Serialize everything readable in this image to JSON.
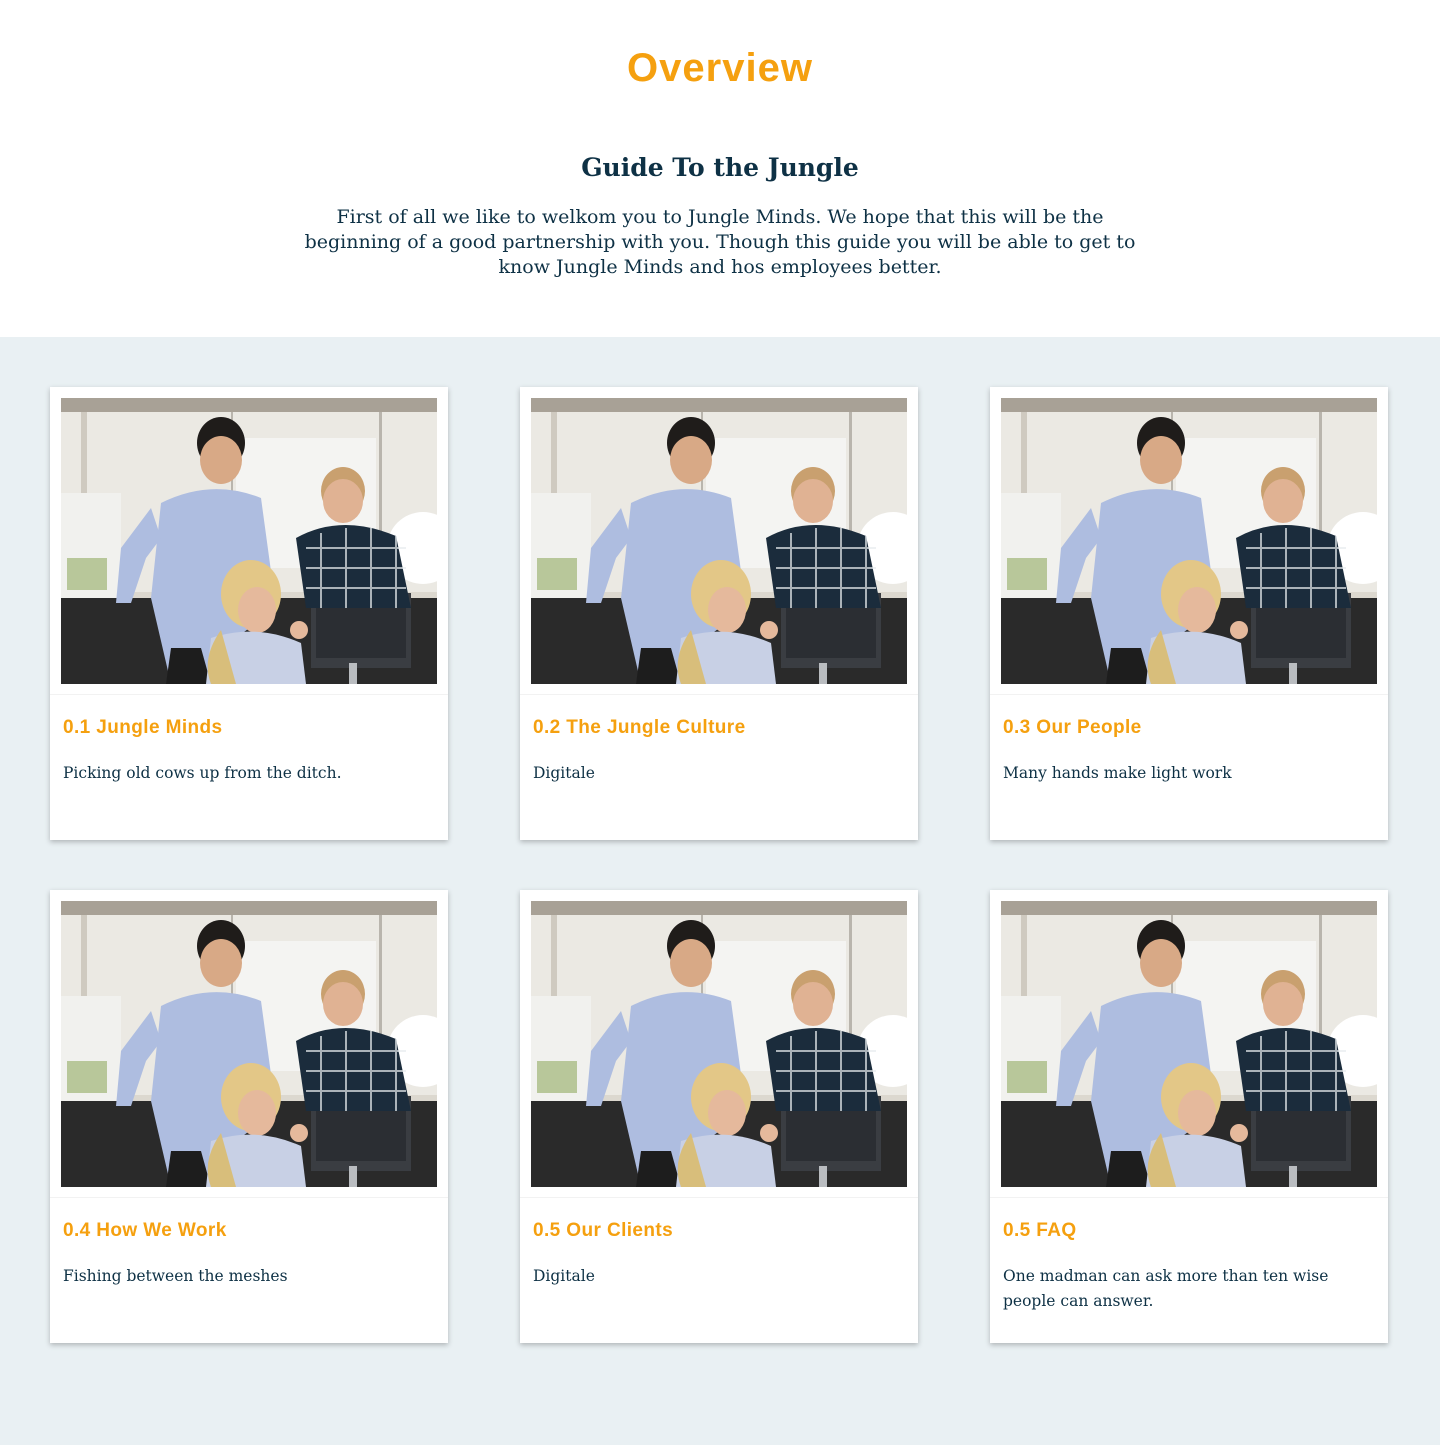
{
  "hero": {
    "overview_title": "Overview",
    "guide_title": "Guide To the Jungle",
    "intro": "First of all we like to welkom you to Jungle Minds. We hope that this will be the beginning of a good partnership with you. Though this guide you will be able to get to know Jungle Minds and hos employees better."
  },
  "colors": {
    "accent": "#f5a00f",
    "navy": "#0e3145",
    "section_bg": "#e9f0f3"
  },
  "cards": [
    {
      "title": "0.1 Jungle Minds",
      "description": "Picking old cows up from the ditch."
    },
    {
      "title": "0.2 The Jungle Culture",
      "description": "Digitale"
    },
    {
      "title": "0.3 Our People",
      "description": "Many hands make light work"
    },
    {
      "title": "0.4 How We Work",
      "description": "Fishing between the meshes"
    },
    {
      "title": "0.5 Our Clients",
      "description": "Digitale"
    },
    {
      "title": "0.5 FAQ",
      "description": "One madman can ask more than ten wise people can answer."
    }
  ]
}
